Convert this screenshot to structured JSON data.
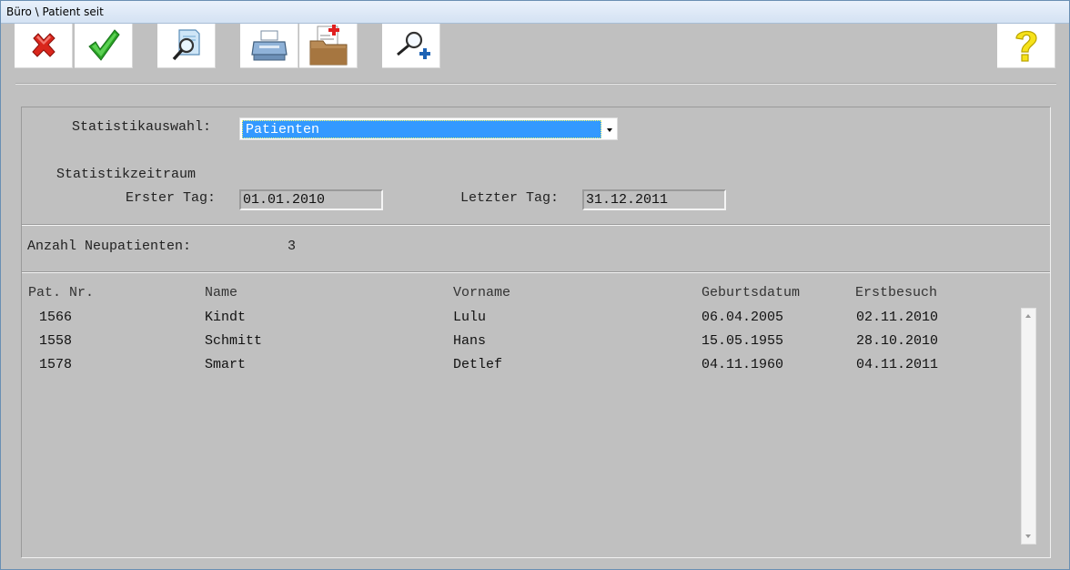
{
  "window": {
    "title": "Büro \\ Patient seit"
  },
  "toolbar": {
    "buttons": [
      {
        "icon": "close-icon"
      },
      {
        "icon": "checkmark-icon"
      },
      {
        "icon": "document-search-icon"
      },
      {
        "icon": "printer-icon"
      },
      {
        "icon": "medical-folder-icon"
      },
      {
        "icon": "zoom-add-icon"
      },
      {
        "icon": "help-icon"
      }
    ]
  },
  "form": {
    "statistic_label": "Statistikauswahl:",
    "statistic_value": "Patienten",
    "period_label": "Statistikzeitraum",
    "first_day_label": "Erster Tag:",
    "first_day_value": "01.01.2010",
    "last_day_label": "Letzter Tag:",
    "last_day_value": "31.12.2011"
  },
  "summary": {
    "count_label": "Anzahl Neupatienten:",
    "count_value": "3"
  },
  "table": {
    "headers": [
      "Pat. Nr.",
      "Name",
      "Vorname",
      "Geburtsdatum",
      "Erstbesuch"
    ],
    "rows": [
      [
        "1566",
        "Kindt",
        "Lulu",
        "06.04.2005",
        "02.11.2010"
      ],
      [
        "1558",
        "Schmitt",
        "Hans",
        "15.05.1955",
        "28.10.2010"
      ],
      [
        "1578",
        "Smart",
        "Detlef",
        "04.11.1960",
        "04.11.2011"
      ]
    ]
  },
  "colors": {
    "selection": "#3399ff",
    "background": "#c0c0c0"
  }
}
